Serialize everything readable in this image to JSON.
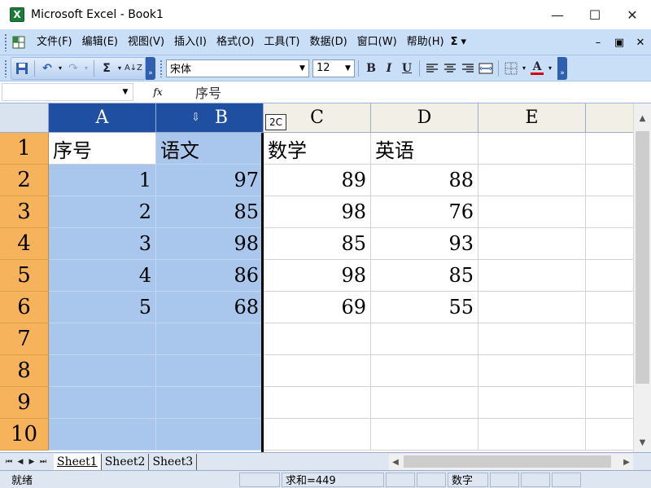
{
  "window": {
    "title": "Microsoft Excel - Book1",
    "app_icon": "X",
    "minimize": "—",
    "maximize": "☐",
    "close": "✕"
  },
  "menu": {
    "items": [
      "文件(F)",
      "编辑(E)",
      "视图(V)",
      "插入(I)",
      "格式(O)",
      "工具(T)",
      "数据(D)",
      "窗口(W)",
      "帮助(H)"
    ],
    "sigma": "Σ",
    "sigma_arrow": "▾",
    "restore_glyphs": [
      "–",
      "▣",
      "✕"
    ]
  },
  "toolbar": {
    "save_icon": "floppy-disk-icon",
    "undo": "↶",
    "redo": "↷",
    "sigma": "Σ",
    "sort": "A↓Z",
    "font_name": "宋体",
    "font_size": "12",
    "bold": "B",
    "italic": "I",
    "underline": "U",
    "font_color_letter": "A",
    "font_color": "#d00000",
    "chevron": "»"
  },
  "formula_bar": {
    "name_box": "",
    "fx": "fx",
    "value": "序号"
  },
  "grid": {
    "columns": [
      "A",
      "B",
      "C",
      "D",
      "E"
    ],
    "selected_columns": [
      "A",
      "B"
    ],
    "rows": [
      "1",
      "2",
      "3",
      "4",
      "5",
      "6",
      "7",
      "8",
      "9",
      "10"
    ],
    "drag_hint": "2C",
    "drag_arrow": "⇩",
    "data": [
      [
        "序号",
        "语文",
        "数学",
        "英语",
        ""
      ],
      [
        "1",
        "97",
        "89",
        "88",
        ""
      ],
      [
        "2",
        "85",
        "98",
        "76",
        ""
      ],
      [
        "3",
        "98",
        "85",
        "93",
        ""
      ],
      [
        "4",
        "86",
        "98",
        "85",
        ""
      ],
      [
        "5",
        "68",
        "69",
        "55",
        ""
      ],
      [
        "",
        "",
        "",
        "",
        ""
      ],
      [
        "",
        "",
        "",
        "",
        ""
      ],
      [
        "",
        "",
        "",
        "",
        ""
      ],
      [
        "",
        "",
        "",
        "",
        ""
      ]
    ]
  },
  "sheets": {
    "tabs": [
      "Sheet1",
      "Sheet2",
      "Sheet3"
    ],
    "active": "Sheet1",
    "nav": [
      "⏮",
      "◀",
      "▶",
      "⏭"
    ]
  },
  "status": {
    "ready": "就绪",
    "sum": "求和=449",
    "mode": "数字"
  }
}
